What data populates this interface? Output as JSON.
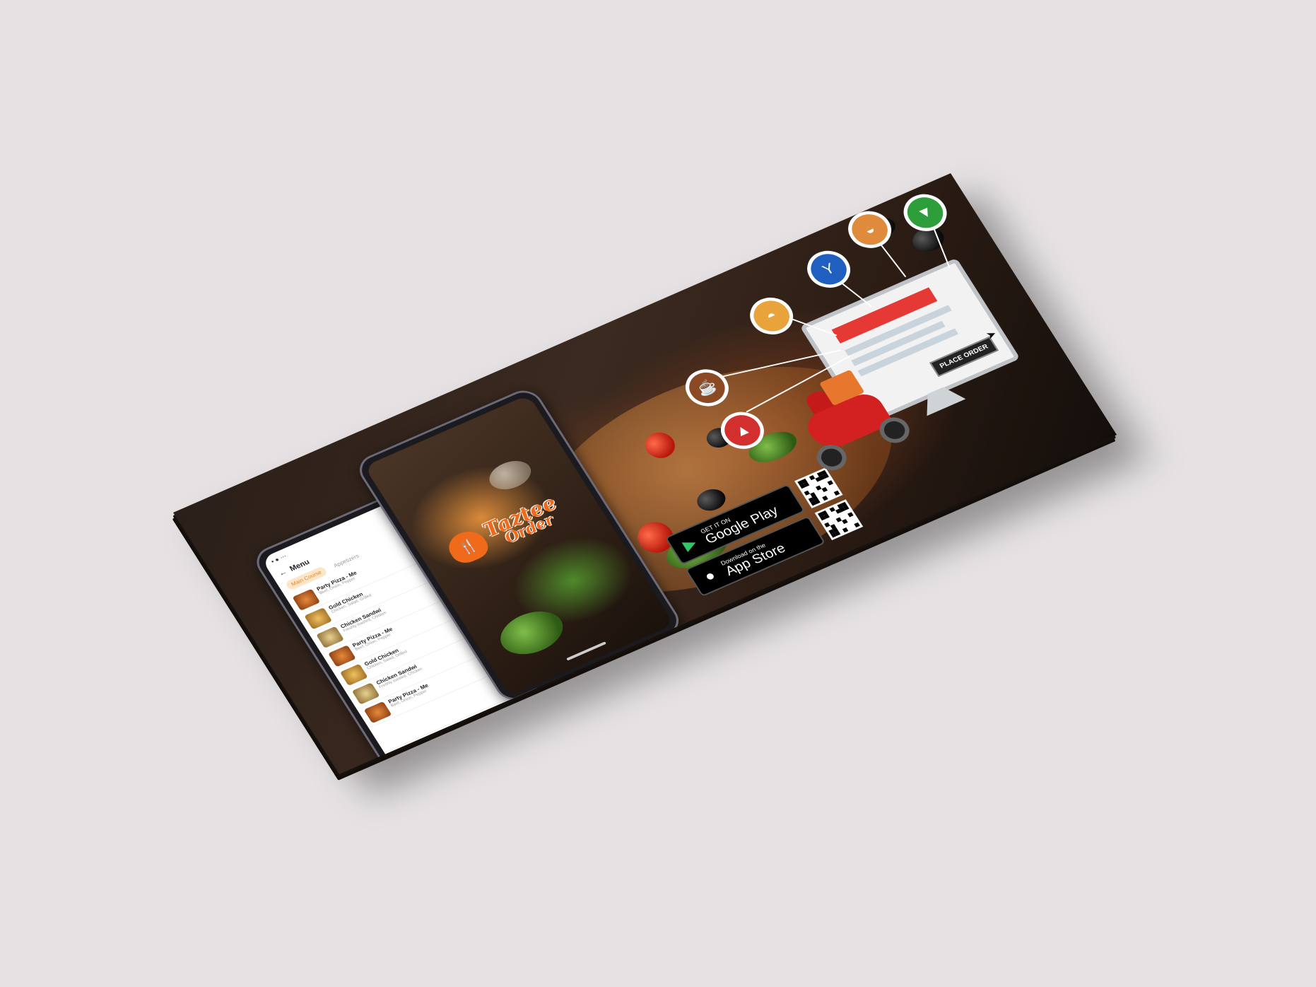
{
  "phone_menu": {
    "header_title": "Menu",
    "tabs": [
      "Main Course",
      "Appetizers"
    ],
    "items": [
      {
        "title": "Party Pizza - Me",
        "desc": "Beef, Onion, Pepper"
      },
      {
        "title": "Gold Chicken",
        "desc": "Chicken, Salad, Grilled"
      },
      {
        "title": "Chicken Sandwi",
        "desc": "Freshly toasted, Chicken"
      },
      {
        "title": "Party Pizza - Me",
        "desc": "Beef, Onion, Pepper"
      },
      {
        "title": "Gold Chicken",
        "desc": "Chicken, Salad, Grilled"
      },
      {
        "title": "Chicken Sandwi",
        "desc": "Freshly toasted, Chicken"
      },
      {
        "title": "Party Pizza - Me",
        "desc": "Beef, Onion, Pepper"
      }
    ]
  },
  "splash": {
    "brand_line1": "Taztee",
    "brand_line2": "Order"
  },
  "stores": {
    "google_small": "GET IT ON",
    "google_big": "Google Play",
    "apple_small": "Download on the",
    "apple_big": "App Store"
  },
  "illustration": {
    "place_order_label": "PLACE ORDER"
  },
  "colors": {
    "brand_orange": "#ef6a1b",
    "accent_red": "#e53935",
    "icon_coffee": "#8b4a24",
    "icon_pizza": "#d32f2f",
    "icon_burger": "#e8a33a",
    "icon_drink": "#1f5fbf",
    "icon_cake": "#e08a3c",
    "icon_icecream": "#2e9e3a"
  },
  "category_icons": [
    "coffee-icon",
    "pizza-icon",
    "burger-icon",
    "cocktail-icon",
    "cake-icon",
    "ice-cream-icon"
  ]
}
